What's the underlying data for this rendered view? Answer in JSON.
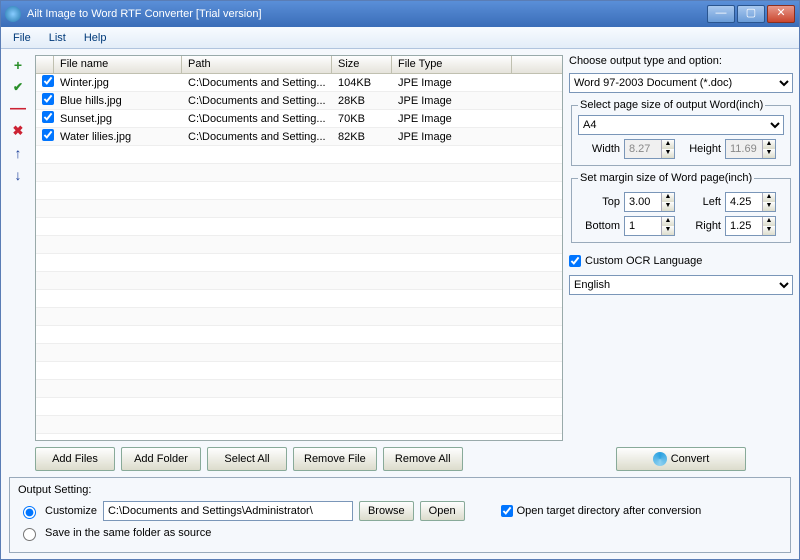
{
  "window": {
    "title": "Ailt Image to Word RTF Converter [Trial version]"
  },
  "menu": {
    "file": "File",
    "list": "List",
    "help": "Help"
  },
  "columns": {
    "name": "File name",
    "path": "Path",
    "size": "Size",
    "type": "File Type"
  },
  "rows": [
    {
      "name": "Winter.jpg",
      "path": "C:\\Documents and Setting...",
      "size": "104KB",
      "type": "JPE Image"
    },
    {
      "name": "Blue hills.jpg",
      "path": "C:\\Documents and Setting...",
      "size": "28KB",
      "type": "JPE Image"
    },
    {
      "name": "Sunset.jpg",
      "path": "C:\\Documents and Setting...",
      "size": "70KB",
      "type": "JPE Image"
    },
    {
      "name": "Water lilies.jpg",
      "path": "C:\\Documents and Setting...",
      "size": "82KB",
      "type": "JPE Image"
    }
  ],
  "right": {
    "choose_label": "Choose output type and option:",
    "output_type": "Word 97-2003 Document (*.doc)",
    "page_size_legend": "Select page size of output Word(inch)",
    "page_size_preset": "A4",
    "width_label": "Width",
    "width_value": "8.27",
    "height_label": "Height",
    "height_value": "11.69",
    "margin_legend": "Set margin size of Word page(inch)",
    "top_label": "Top",
    "top_value": "3.00",
    "left_label": "Left",
    "left_value": "4.25",
    "bottom_label": "Bottom",
    "bottom_value": "1",
    "right_label": "Right",
    "right_value": "1.25",
    "ocr_label": "Custom OCR Language",
    "ocr_lang": "English"
  },
  "buttons": {
    "add_files": "Add Files",
    "add_folder": "Add Folder",
    "select_all": "Select All",
    "remove_file": "Remove File",
    "remove_all": "Remove All",
    "convert": "Convert",
    "browse": "Browse",
    "open": "Open"
  },
  "output": {
    "legend": "Output Setting:",
    "customize": "Customize",
    "save_same": "Save in the same folder as source",
    "path": "C:\\Documents and Settings\\Administrator\\",
    "open_after": "Open target directory after conversion"
  }
}
